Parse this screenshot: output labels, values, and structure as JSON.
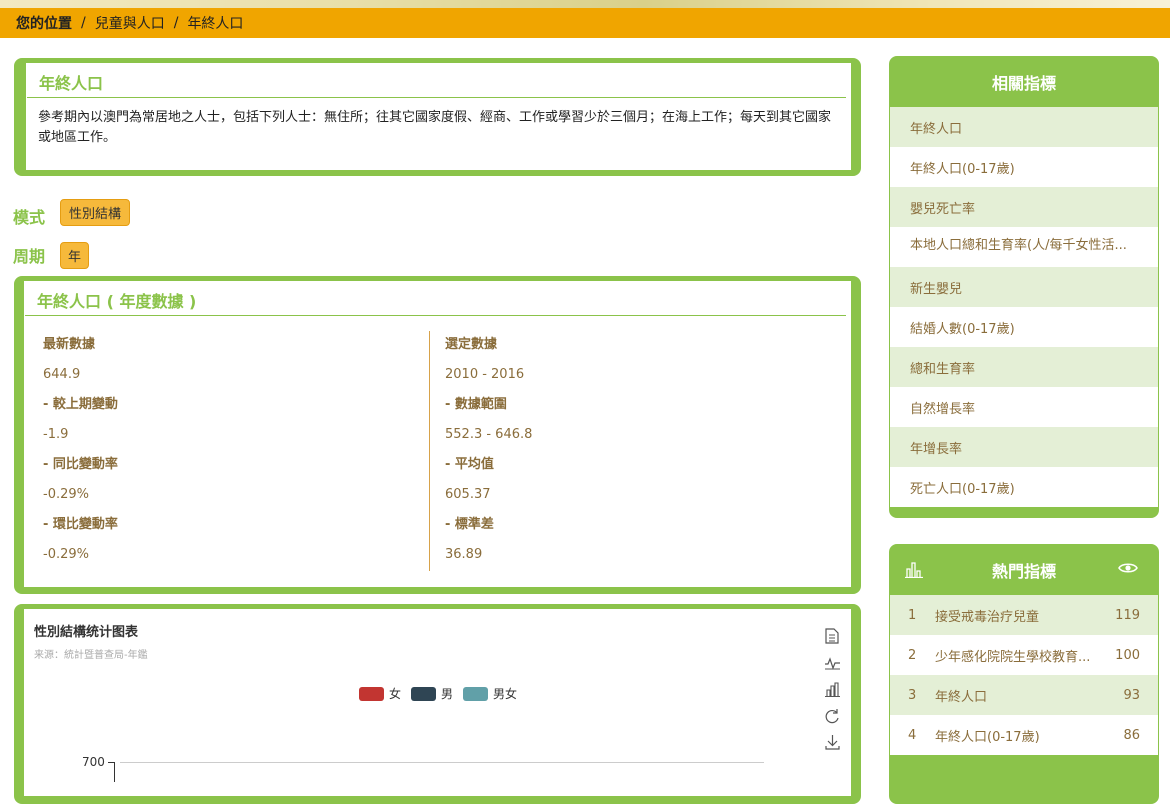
{
  "breadcrumb": {
    "position_label": "您的位置",
    "sep1": "/",
    "section": "兒童與人口",
    "sep2": "/",
    "current": "年終人口"
  },
  "definition": {
    "title": "年終人口",
    "text": "參考期內以澳門為常居地之人士，包括下列人士：無住所；往其它國家度假、經商、工作或學習少於三個月；在海上工作；每天到其它國家或地區工作。"
  },
  "mode": {
    "label": "模式",
    "value": "性別結構"
  },
  "period": {
    "label": "周期",
    "value": "年"
  },
  "annual": {
    "title": "年終人口 ( 年度數據 )",
    "left": {
      "latest_label": "最新數據",
      "latest_value": "644.9",
      "change_label": "- 較上期變動",
      "change_value": "-1.9",
      "yoy_label": "- 同比變動率",
      "yoy_value": "-0.29%",
      "qoq_label": "- 環比變動率",
      "qoq_value": "-0.29%"
    },
    "right": {
      "selected_label": "選定數據",
      "selected_value": "2010 - 2016",
      "range_label": "- 數據範圍",
      "range_value": "552.3 - 646.8",
      "avg_label": "- 平均值",
      "avg_value": "605.37",
      "std_label": "- 標準差",
      "std_value": "36.89"
    }
  },
  "chart": {
    "title": "性別結構统计图表",
    "source": "来源：統計暨普查局-年鑑",
    "legend": [
      {
        "name": "女",
        "color": "#c23531"
      },
      {
        "name": "男",
        "color": "#2f4554"
      },
      {
        "name": "男女",
        "color": "#61a0a8"
      }
    ],
    "y_tick_top": "700"
  },
  "related": {
    "title": "相關指標",
    "items": [
      "年終人口",
      "年終人口(0-17歲)",
      "嬰兒死亡率",
      "本地人口總和生育率(人/每千女性活...",
      "新生嬰兒",
      "結婚人數(0-17歲)",
      "總和生育率",
      "自然增長率",
      "年增長率",
      "死亡人口(0-17歲)"
    ]
  },
  "hot": {
    "title": "熱門指標",
    "items": [
      {
        "rank": "1",
        "name": "接受戒毒治疗兒童",
        "count": "119"
      },
      {
        "rank": "2",
        "name": "少年感化院院生學校教育...",
        "count": "100"
      },
      {
        "rank": "3",
        "name": "年終人口",
        "count": "93"
      },
      {
        "rank": "4",
        "name": "年終人口(0-17歲)",
        "count": "86"
      }
    ]
  },
  "colors": {
    "accent_green": "#8bc34a",
    "breadcrumb_bar": "#f0a500",
    "tag_orange": "#f6b93b"
  }
}
